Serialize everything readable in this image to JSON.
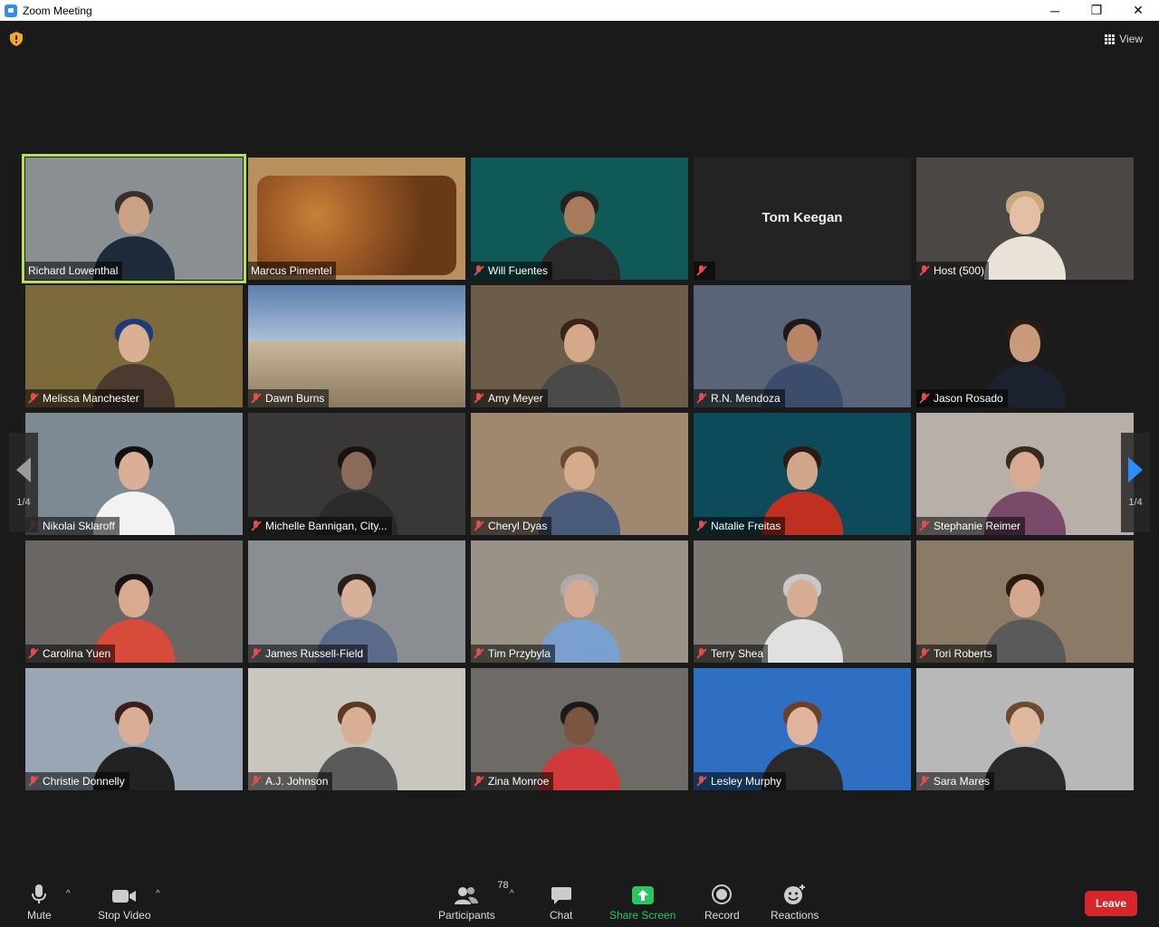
{
  "window": {
    "title": "Zoom Meeting",
    "minimize": "─",
    "maximize": "❐",
    "close": "✕"
  },
  "header": {
    "view_label": "View",
    "shield_color": "#f5a623"
  },
  "pagination": {
    "left_label": "1/4",
    "right_label": "1/4"
  },
  "participants": [
    {
      "name": "Richard Lowenthal",
      "muted": false,
      "active": true,
      "bg": "#8a8f94",
      "skin": "#c9a185",
      "hair": "#3a2f2a",
      "shirt": "#1f2a3a"
    },
    {
      "name": "Marcus Pimentel",
      "muted": false,
      "bg": "#b8905e",
      "image": "food"
    },
    {
      "name": "Will Fuentes",
      "muted": true,
      "bg": "#0f5a57",
      "skin": "#a87a5c",
      "hair": "#222",
      "shirt": "#2a2a2a"
    },
    {
      "name": "Tom Keegan",
      "muted": true,
      "bg": "#232323",
      "no_video": true
    },
    {
      "name": "Host (500)",
      "muted": true,
      "bg": "#4a4744",
      "skin": "#e3bfa6",
      "hair": "#c9a77a",
      "shirt": "#e9e2d8"
    },
    {
      "name": "Melissa Manchester",
      "muted": true,
      "bg": "#7c6a3a",
      "skin": "#d9b094",
      "hair": "#1f3a7a",
      "shirt": "#4a3a30"
    },
    {
      "name": "Dawn Burns",
      "muted": true,
      "bg": "#7a93b8",
      "image": "building"
    },
    {
      "name": "Amy Meyer",
      "muted": true,
      "bg": "#6b5d4a",
      "skin": "#d6a88a",
      "hair": "#3a2418",
      "shirt": "#4a4a4a"
    },
    {
      "name": "R.N. Mendoza",
      "muted": true,
      "bg": "#5a6478",
      "skin": "#b98464",
      "hair": "#1a1a1a",
      "shirt": "#3b4d6a"
    },
    {
      "name": "Jason Rosado",
      "muted": true,
      "bg": "#1b1b1b",
      "skin": "#c99b7a",
      "hair": "#2a1c12",
      "shirt": "#1c2130"
    },
    {
      "name": "Nikolai Sklaroff",
      "muted": true,
      "bg": "#7d8a93",
      "skin": "#d9b096",
      "hair": "#111",
      "shirt": "#f2f2f2"
    },
    {
      "name": "Michelle Bannigan, City...",
      "muted": true,
      "bg": "#3a3836",
      "skin": "#8a6a58",
      "hair": "#1a1212",
      "shirt": "#2a2a2a"
    },
    {
      "name": "Cheryl Dyas",
      "muted": true,
      "bg": "#a08870",
      "skin": "#d6ab8d",
      "hair": "#6a4a30",
      "shirt": "#4a5a7a"
    },
    {
      "name": "Natalie Freitas",
      "muted": true,
      "bg": "#0e4b5a",
      "skin": "#d2a68a",
      "hair": "#2a1a10",
      "shirt": "#c03020"
    },
    {
      "name": "Stephanie Reimer",
      "muted": true,
      "bg": "#b8b0a8",
      "skin": "#d8aa92",
      "hair": "#3a2a22",
      "shirt": "#7a4a6a"
    },
    {
      "name": "Carolina Yuen",
      "muted": true,
      "bg": "#6a6664",
      "skin": "#d9a990",
      "hair": "#1a1212",
      "shirt": "#d84a3a"
    },
    {
      "name": "James Russell-Field",
      "muted": true,
      "bg": "#8a8e92",
      "skin": "#d8b09a",
      "hair": "#2a1e18",
      "shirt": "#5a6a8a"
    },
    {
      "name": "Tim Przybyla",
      "muted": true,
      "bg": "#9a9284",
      "skin": "#d6aa90",
      "hair": "#aaa",
      "shirt": "#7aa0d0"
    },
    {
      "name": "Terry Shea",
      "muted": true,
      "bg": "#7a7870",
      "skin": "#d6ad94",
      "hair": "#c8c8c8",
      "shirt": "#e0e0e0"
    },
    {
      "name": "Tori Roberts",
      "muted": true,
      "bg": "#8a7a66",
      "skin": "#d4a88e",
      "hair": "#2a1a12",
      "shirt": "#5a5a5a"
    },
    {
      "name": "Christie Donnelly",
      "muted": true,
      "bg": "#9aa6b4",
      "skin": "#d9ad96",
      "hair": "#3a1f18",
      "shirt": "#222"
    },
    {
      "name": "A.J. Johnson",
      "muted": true,
      "bg": "#c9c5bf",
      "skin": "#d8ae94",
      "hair": "#5a3a22",
      "shirt": "#5a5a5a"
    },
    {
      "name": "Zina Monroe",
      "muted": true,
      "bg": "#6e6a66",
      "skin": "#7a5540",
      "hair": "#1a1a1a",
      "shirt": "#d03a3a"
    },
    {
      "name": "Lesley Murphy",
      "muted": true,
      "bg": "#2e6fc4",
      "skin": "#e0b49c",
      "hair": "#6a4028",
      "shirt": "#2a2a2a"
    },
    {
      "name": "Sara Mares",
      "muted": true,
      "bg": "#b8b8b8",
      "skin": "#e0b8a0",
      "hair": "#6a4a30",
      "shirt": "#2a2a2a"
    }
  ],
  "toolbar": {
    "mute": "Mute",
    "stop_video": "Stop Video",
    "participants": "Participants",
    "participants_count": "78",
    "chat": "Chat",
    "share_screen": "Share Screen",
    "record": "Record",
    "reactions": "Reactions",
    "leave": "Leave"
  },
  "colors": {
    "accent_green": "#2ac75e",
    "leave_red": "#d7262b",
    "active_speaker": "#b9e14a",
    "muted_red": "#e34d4d"
  }
}
